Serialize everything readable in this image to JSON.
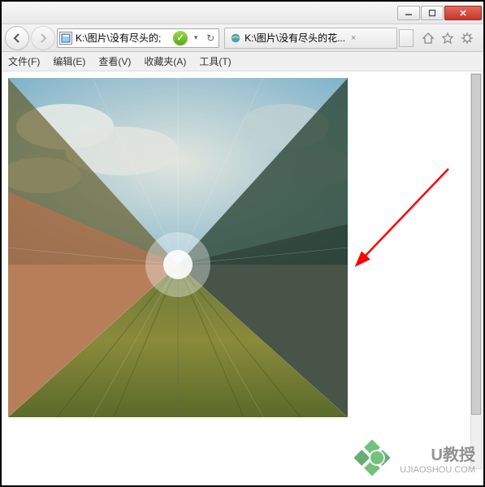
{
  "titlebar": {
    "minimize": "—",
    "maximize": "□",
    "close": "×"
  },
  "nav": {
    "address_path": "K:\\图片\\没有尽头的;",
    "dropdown_glyph": "▾",
    "refresh_glyph": "↻"
  },
  "tab": {
    "title": "K:\\图片\\没有尽头的花...",
    "close_glyph": "×"
  },
  "menu": {
    "file": "文件(F)",
    "edit": "编辑(E)",
    "view": "查看(V)",
    "favorites": "收藏夹(A)",
    "tools": "工具(T)"
  },
  "watermark": {
    "brand": "U教授",
    "url": "UJIAOSHOU.COM"
  }
}
